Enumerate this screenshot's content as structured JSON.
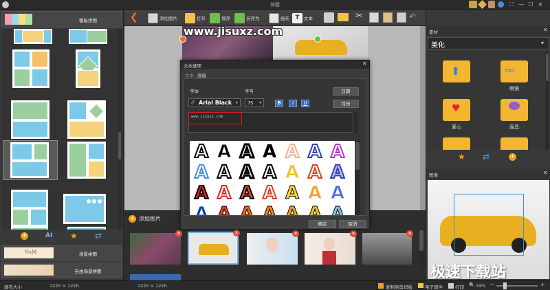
{
  "window": {
    "title": "排版",
    "controls": [
      "⛶",
      "—",
      "☐",
      "✕"
    ]
  },
  "left_panel": {
    "top_tab": "模板拼图",
    "bottom_tabs": [
      "场景拼图",
      "自由场景拼图"
    ],
    "scene_thumb_text": "NxM",
    "bottom_tool_ai": "AI"
  },
  "toolbar": {
    "add_image": "添加图片",
    "open": "打开",
    "save": "保存",
    "save_as": "另存为",
    "canvas": "画布",
    "text": "文本"
  },
  "canvas": {
    "watermark": "www.jisuxz.com"
  },
  "dialog": {
    "title": "文本选项",
    "tabs": [
      "文本",
      "高级"
    ],
    "font_label": "字体",
    "size_label": "字号",
    "font_value": "Arial Black",
    "size_value": "75",
    "style_buttons": [
      "B",
      "I",
      "U"
    ],
    "date_button": "日期",
    "month_button": "月份",
    "text_value": "www.jisuxz.com",
    "ok": "确定",
    "cancel": "取消",
    "sample_glyph": "A"
  },
  "strip": {
    "add_image": "添加图片"
  },
  "right_panel": {
    "materials_title": "素材",
    "category": "美化",
    "items": [
      "",
      "眼镜",
      "爱心",
      "面具",
      "",
      ""
    ],
    "image_title": "图像"
  },
  "status": {
    "canvas_size_label": "画布大小",
    "canvas_size": "1220 × 1220",
    "image_size": "1220 × 1220",
    "copy": "复制到剪切板",
    "email": "电子邮件",
    "print": "打印",
    "zoom": "34%"
  },
  "site_watermark": "极速下载站",
  "colors": {
    "accent": "#e8a21a",
    "selection": "#3a8fd8",
    "dialog_title": "#2b2b2b",
    "highlight_red": "#e02020"
  }
}
